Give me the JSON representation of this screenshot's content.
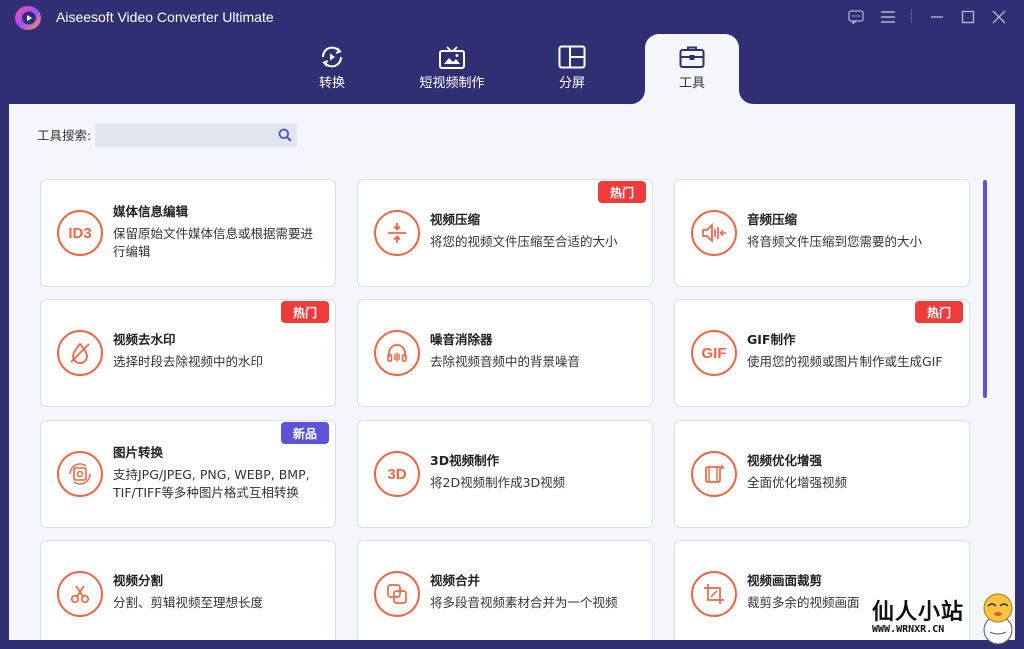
{
  "window": {
    "title": "Aiseesoft Video Converter Ultimate"
  },
  "nav": {
    "tabs": [
      {
        "label": "转换",
        "icon": "convert-icon"
      },
      {
        "label": "短视频制作",
        "icon": "mv-icon"
      },
      {
        "label": "分屏",
        "icon": "collage-icon"
      },
      {
        "label": "工具",
        "icon": "toolbox-icon",
        "active": true
      }
    ]
  },
  "search": {
    "label": "工具搜索:",
    "value": "",
    "placeholder": ""
  },
  "tools": [
    {
      "title": "媒体信息编辑",
      "desc": "保留原始文件媒体信息或根据需要进行编辑",
      "icon": "id3-icon",
      "icon_text": "ID3",
      "badge": ""
    },
    {
      "title": "视频压缩",
      "desc": "将您的视频文件压缩至合适的大小",
      "icon": "compress-icon",
      "icon_text": "",
      "badge": "热门"
    },
    {
      "title": "音频压缩",
      "desc": "将音频文件压缩到您需要的大小",
      "icon": "audio-compress-icon",
      "icon_text": "",
      "badge": ""
    },
    {
      "title": "视频去水印",
      "desc": "选择时段去除视频中的水印",
      "icon": "watermark-remove-icon",
      "icon_text": "",
      "badge": "热门"
    },
    {
      "title": "噪音消除器",
      "desc": "去除视频音频中的背景噪音",
      "icon": "headphone-icon",
      "icon_text": "",
      "badge": ""
    },
    {
      "title": "GIF制作",
      "desc": "使用您的视频或图片制作或生成GIF",
      "icon": "gif-icon",
      "icon_text": "GIF",
      "badge": "热门"
    },
    {
      "title": "图片转换",
      "desc": "支持JPG/JPEG, PNG, WEBP, BMP, TIF/TIFF等多种图片格式互相转换",
      "icon": "image-convert-icon",
      "icon_text": "",
      "badge": "新品"
    },
    {
      "title": "3D视频制作",
      "desc": "将2D视频制作成3D视频",
      "icon": "3d-icon",
      "icon_text": "3D",
      "badge": ""
    },
    {
      "title": "视频优化增强",
      "desc": "全面优化增强视频",
      "icon": "enhance-icon",
      "icon_text": "",
      "badge": ""
    },
    {
      "title": "视频分割",
      "desc": "分割、剪辑视频至理想长度",
      "icon": "scissors-icon",
      "icon_text": "",
      "badge": ""
    },
    {
      "title": "视频合并",
      "desc": "将多段音视频素材合并为一个视频",
      "icon": "merge-icon",
      "icon_text": "",
      "badge": ""
    },
    {
      "title": "视频画面裁剪",
      "desc": "裁剪多余的视频画面",
      "icon": "crop-icon",
      "icon_text": "",
      "badge": ""
    }
  ],
  "watermark": {
    "line1": "仙人小站",
    "line2": "WWW.WRNXR.CN"
  },
  "colors": {
    "titlebar": "#302f73",
    "accent": "#f06545",
    "hot_badge": "#ee3b3b",
    "new_badge": "#5b54d6"
  }
}
